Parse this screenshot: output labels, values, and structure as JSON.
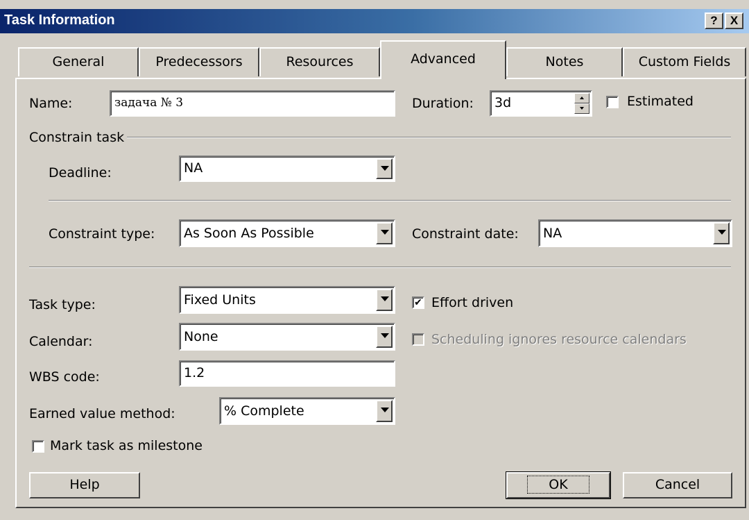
{
  "window": {
    "title": "Task Information",
    "help_glyph": "?",
    "close_glyph": "X"
  },
  "tabs": [
    {
      "label": "General"
    },
    {
      "label": "Predecessors"
    },
    {
      "label": "Resources"
    },
    {
      "label": "Advanced"
    },
    {
      "label": "Notes"
    },
    {
      "label": "Custom Fields"
    }
  ],
  "active_tab": "Advanced",
  "form": {
    "name_label": "Name:",
    "name_value": "задача № 3",
    "duration_label": "Duration:",
    "duration_value": "3d",
    "estimated_label": "Estimated",
    "estimated_checked": false,
    "constrain_group": "Constrain task",
    "deadline_label": "Deadline:",
    "deadline_value": "NA",
    "constraint_type_label": "Constraint type:",
    "constraint_type_value": "As Soon As Possible",
    "constraint_date_label": "Constraint date:",
    "constraint_date_value": "NA",
    "task_type_label": "Task type:",
    "task_type_value": "Fixed Units",
    "effort_driven_label": "Effort driven",
    "effort_driven_checked": true,
    "check_glyph": "✔",
    "calendar_label": "Calendar:",
    "calendar_value": "None",
    "scheduling_label": "Scheduling ignores resource calendars",
    "scheduling_checked": false,
    "wbs_label": "WBS code:",
    "wbs_value": "1.2",
    "evm_label": "Earned value method:",
    "evm_value": "% Complete",
    "milestone_label": "Mark task as milestone",
    "milestone_checked": false
  },
  "buttons": {
    "help": "Help",
    "ok": "OK",
    "cancel": "Cancel"
  }
}
